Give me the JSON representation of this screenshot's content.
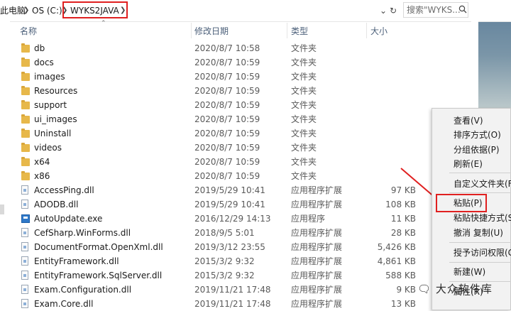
{
  "address": {
    "this_pc": "此电脑",
    "drive": "OS (C:)",
    "folder": "WYKS2JAVA",
    "search_placeholder": "搜索\"WYKS..."
  },
  "columns": {
    "name": "名称",
    "date": "修改日期",
    "type": "类型",
    "size": "大小"
  },
  "files": [
    {
      "name": "db",
      "date": "2020/8/7 10:58",
      "type": "文件夹",
      "size": "",
      "icon": "folder-icon"
    },
    {
      "name": "docs",
      "date": "2020/8/7 10:59",
      "type": "文件夹",
      "size": "",
      "icon": "folder-icon"
    },
    {
      "name": "images",
      "date": "2020/8/7 10:59",
      "type": "文件夹",
      "size": "",
      "icon": "folder-icon"
    },
    {
      "name": "Resources",
      "date": "2020/8/7 10:59",
      "type": "文件夹",
      "size": "",
      "icon": "folder-icon"
    },
    {
      "name": "support",
      "date": "2020/8/7 10:59",
      "type": "文件夹",
      "size": "",
      "icon": "folder-icon"
    },
    {
      "name": "ui_images",
      "date": "2020/8/7 10:59",
      "type": "文件夹",
      "size": "",
      "icon": "folder-icon"
    },
    {
      "name": "Uninstall",
      "date": "2020/8/7 10:59",
      "type": "文件夹",
      "size": "",
      "icon": "folder-icon"
    },
    {
      "name": "videos",
      "date": "2020/8/7 10:59",
      "type": "文件夹",
      "size": "",
      "icon": "folder-icon"
    },
    {
      "name": "x64",
      "date": "2020/8/7 10:59",
      "type": "文件夹",
      "size": "",
      "icon": "folder-icon"
    },
    {
      "name": "x86",
      "date": "2020/8/7 10:59",
      "type": "文件夹",
      "size": "",
      "icon": "folder-icon"
    },
    {
      "name": "AccessPing.dll",
      "date": "2019/5/29 10:41",
      "type": "应用程序扩展",
      "size": "97 KB",
      "icon": "dll-file-icon"
    },
    {
      "name": "ADODB.dll",
      "date": "2019/5/29 10:41",
      "type": "应用程序扩展",
      "size": "108 KB",
      "icon": "dll-file-icon"
    },
    {
      "name": "AutoUpdate.exe",
      "date": "2016/12/29 14:13",
      "type": "应用程序",
      "size": "11 KB",
      "icon": "exe-file-icon"
    },
    {
      "name": "CefSharp.WinForms.dll",
      "date": "2018/9/5 5:01",
      "type": "应用程序扩展",
      "size": "28 KB",
      "icon": "dll-file-icon"
    },
    {
      "name": "DocumentFormat.OpenXml.dll",
      "date": "2019/3/12 23:55",
      "type": "应用程序扩展",
      "size": "5,426 KB",
      "icon": "dll-file-icon"
    },
    {
      "name": "EntityFramework.dll",
      "date": "2015/3/2 9:32",
      "type": "应用程序扩展",
      "size": "4,861 KB",
      "icon": "dll-file-icon"
    },
    {
      "name": "EntityFramework.SqlServer.dll",
      "date": "2015/3/2 9:32",
      "type": "应用程序扩展",
      "size": "588 KB",
      "icon": "dll-file-icon"
    },
    {
      "name": "Exam.Configuration.dll",
      "date": "2019/11/21 17:48",
      "type": "应用程序扩展",
      "size": "9 KB",
      "icon": "dll-file-icon"
    },
    {
      "name": "Exam.Core.dll",
      "date": "2019/11/21 17:48",
      "type": "应用程序扩展",
      "size": "13 KB",
      "icon": "dll-file-icon"
    }
  ],
  "context_menu": {
    "view": "查看(V)",
    "sort": "排序方式(O)",
    "group": "分组依据(P)",
    "refresh": "刷新(E)",
    "customize": "自定义文件夹(F)",
    "paste": "粘贴(P)",
    "paste_shortcut": "粘贴快捷方式(S)",
    "undo_copy": "撤消 复制(U)",
    "grant_access": "授予访问权限(G)",
    "new": "新建(W)",
    "properties": "属性(R)"
  },
  "watermark": "大众软件库",
  "colors": {
    "highlight": "#e02020",
    "folder": "#e7b84a",
    "header_text": "#4c607a"
  }
}
